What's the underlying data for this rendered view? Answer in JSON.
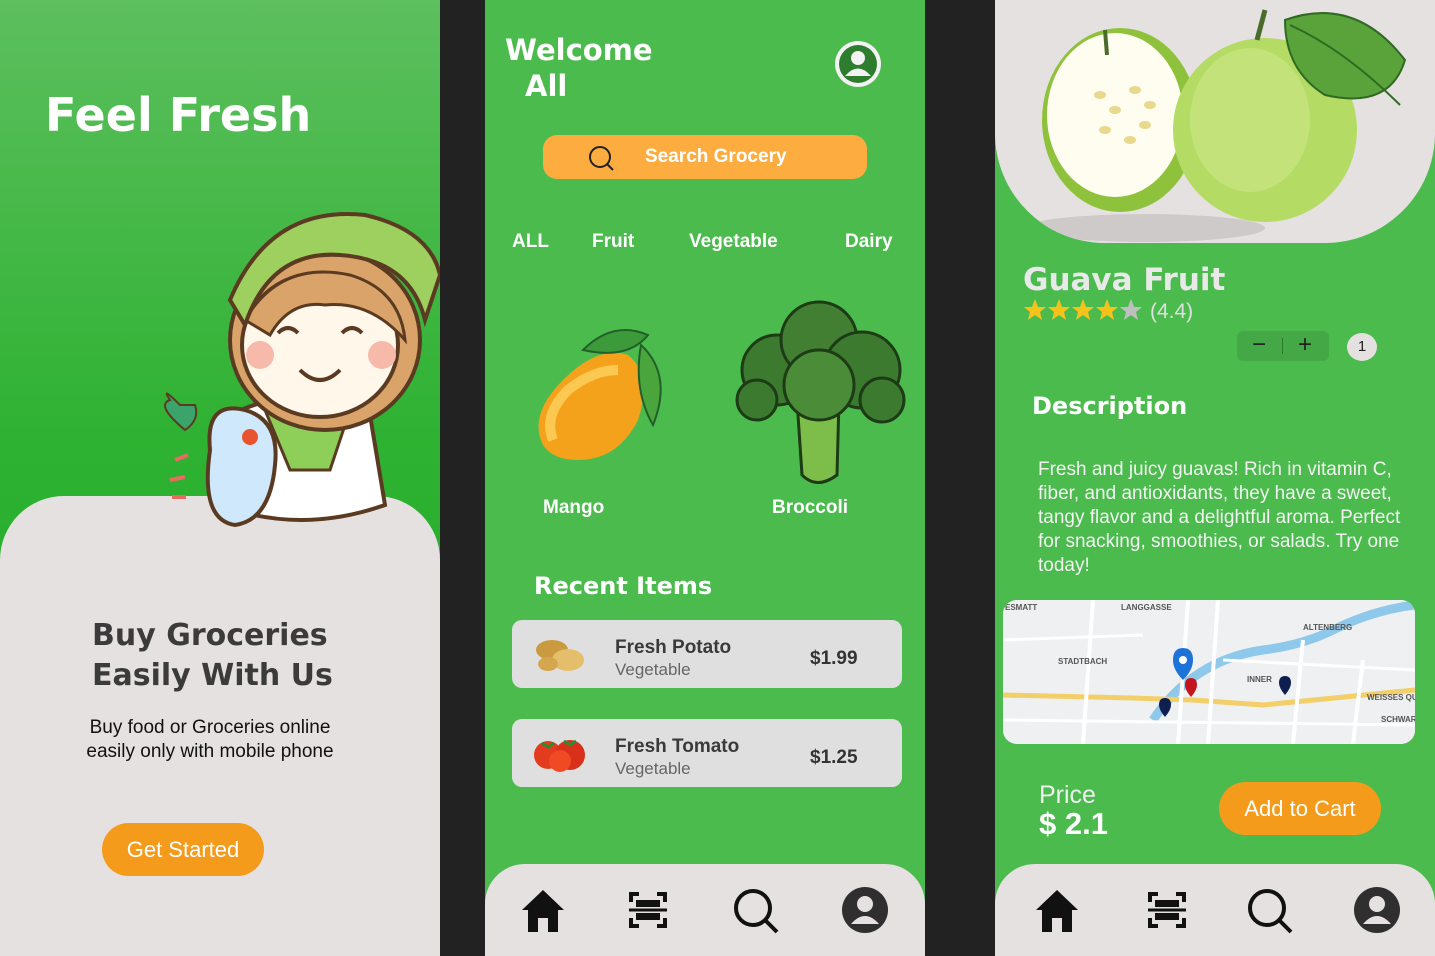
{
  "screen1": {
    "title": "Feel Fresh",
    "headline_line1": "Buy Groceries",
    "headline_line2": "Easily With Us",
    "subtext_line1": "Buy food or Groceries online",
    "subtext_line2": "easily only with mobile phone",
    "cta": "Get Started"
  },
  "screen2": {
    "welcome_line1": "Welcome",
    "welcome_line2": "All",
    "search_placeholder": "Search Grocery",
    "categories": [
      "ALL",
      "Fruit",
      "Vegetable",
      "Dairy"
    ],
    "featured": [
      {
        "name": "Mango",
        "image": "mango-illustration"
      },
      {
        "name": "Broccoli",
        "image": "broccoli-illustration"
      }
    ],
    "recent_title": "Recent Items",
    "recent": [
      {
        "name": "Fresh Potato",
        "type": "Vegetable",
        "price": "$1.99",
        "image": "potato-thumbnail"
      },
      {
        "name": "Fresh Tomato",
        "type": "Vegetable",
        "price": "$1.25",
        "image": "tomato-thumbnail"
      }
    ]
  },
  "screen3": {
    "product_name": "Guava Fruit",
    "rating_text": "(4.4)",
    "rating_value": 4.4,
    "stepper_minus": "−",
    "stepper_plus": "+",
    "quantity": "1",
    "description_title": "Description",
    "description": "Fresh and juicy guavas! Rich in vitamin C, fiber, and antioxidants, they have a sweet, tangy flavor and a delightful aroma. Perfect for snacking, smoothies, or salads. Try one today!",
    "map_labels": [
      "ESMATT",
      "LANGGASSE",
      "ALTENBERG",
      "STADTBACH",
      "INNER",
      "WEISSES QUARTIER",
      "SCHWAR QUART"
    ],
    "price_label": "Price",
    "price_value": "$ 2.1",
    "cta": "Add to Cart"
  },
  "nav_icons": [
    "home-icon",
    "scan-icon",
    "search-icon",
    "profile-icon"
  ],
  "colors": {
    "green": "#4cbb4e",
    "orange": "#f49b1c",
    "search_orange": "#fdac3f",
    "card_gray": "#e6e1e1"
  }
}
